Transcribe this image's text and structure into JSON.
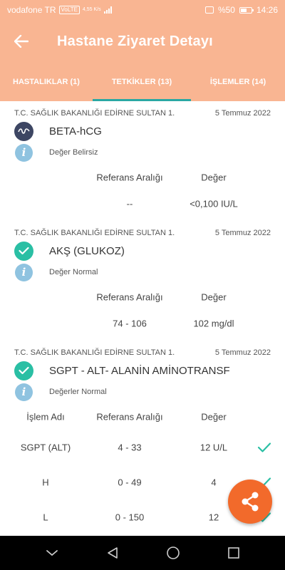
{
  "status_bar": {
    "carrier": "vodafone TR",
    "volte": "VoLTE",
    "net_speed": "4,55 K/s",
    "battery": "%50",
    "time": "14:26"
  },
  "header": {
    "title": "Hastane Ziyaret Detayı"
  },
  "tabs": [
    {
      "label": "HASTALIKLAR (1)"
    },
    {
      "label": "TETKİKLER (13)"
    },
    {
      "label": "İŞLEMLER (14)"
    }
  ],
  "columns": {
    "name": "İşlem Adı",
    "ref": "Referans Aralığı",
    "value": "Değer"
  },
  "tests": [
    {
      "hospital": "T.C. SAĞLIK BAKANLIĞI EDİRNE SULTAN 1.",
      "date": "5 Temmuz 2022",
      "name": "BETA-hCG",
      "status_icon": "wave-icon",
      "status_text": "Değer Belirsiz",
      "ref": "--",
      "value": "<0,100 IU/L"
    },
    {
      "hospital": "T.C. SAĞLIK BAKANLIĞI EDİRNE SULTAN 1.",
      "date": "5 Temmuz 2022",
      "name": "AKŞ (GLUKOZ)",
      "status_icon": "check-icon",
      "status_text": "Değer Normal",
      "ref": "74 - 106",
      "value": "102 mg/dl"
    },
    {
      "hospital": "T.C. SAĞLIK BAKANLIĞI EDİRNE SULTAN 1.",
      "date": "5 Temmuz 2022",
      "name": "SGPT - ALT- ALANİN AMİNOTRANSF",
      "status_icon": "check-icon",
      "status_text": "Değerler Normal",
      "rows": [
        {
          "name": "SGPT (ALT)",
          "ref": "4 - 33",
          "value": "12 U/L"
        },
        {
          "name": "H",
          "ref": "0 - 49",
          "value": "4"
        },
        {
          "name": "L",
          "ref": "0 - 150",
          "value": "12"
        }
      ]
    }
  ],
  "colors": {
    "header_bg": "#f9b592",
    "tab_indicator": "#2aa8a3",
    "check_green": "#2abfa4",
    "fab": "#f26a2b"
  }
}
